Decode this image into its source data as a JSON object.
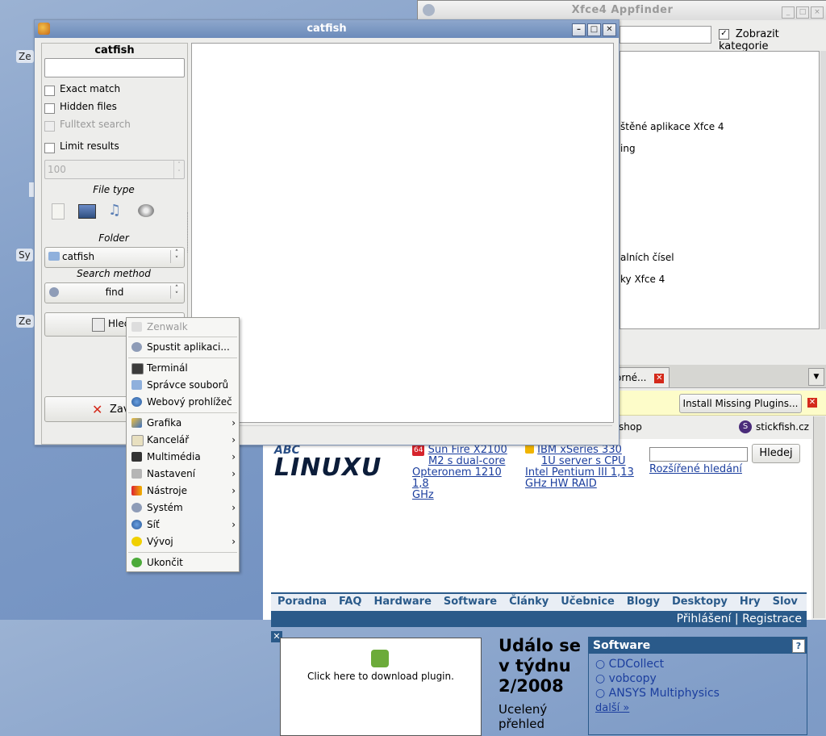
{
  "desktop": {
    "stubs": [
      "Ze",
      "Sy",
      "Ze"
    ]
  },
  "appfinder": {
    "title": "Xfce4 Appfinder",
    "show_categories_label": "Zobrazit kategorie",
    "list_fragments": [
      "štěné aplikace Xfce 4",
      "ing",
      "alních čísel",
      "ky Xfce 4"
    ]
  },
  "browser": {
    "tab_label": "orné...",
    "plugin_button": "Install Missing Plugins...",
    "bookmark_fragment": "shop",
    "bookmark_site": "stickfish.cz",
    "ad1": {
      "badge": "64",
      "line1": "Sun Fire X2100",
      "line2": "M2 s dual-core",
      "line3": "Opteronem 1210 1,8",
      "line4": "GHz"
    },
    "ad2": {
      "line1": "IBM xSeries 330",
      "line2": "1U server s CPU",
      "line3": "Intel Pentium III 1,13",
      "line4": "GHz HW RAID"
    },
    "search_button": "Hledej",
    "advanced_search": "Rozšířené hledání",
    "logo": "ABC LINUXU",
    "nav": [
      "Poradna",
      "FAQ",
      "Hardware",
      "Software",
      "Články",
      "Učebnice",
      "Blogy",
      "Desktopy",
      "Hry",
      "Slov"
    ],
    "login": "Přihlášení",
    "register": "Registrace",
    "plugin_text": "Click here to download plugin.",
    "headline": [
      "Událo se",
      "v týdnu",
      "2/2008"
    ],
    "teaser": [
      "Ucelený",
      "přehled"
    ],
    "software_box": {
      "title": "Software",
      "items": [
        "CDCollect",
        "vobcopy",
        "ANSYS Multiphysics"
      ],
      "more": "další »"
    }
  },
  "catfish": {
    "title": "catfish",
    "panel_title": "catfish",
    "search_value": "",
    "options": {
      "exact": "Exact match",
      "hidden": "Hidden files",
      "fulltext": "Fulltext search",
      "limit": "Limit results"
    },
    "limit_value": "100",
    "file_type_label": "File type",
    "folder_label": "Folder",
    "folder_value": "catfish",
    "method_label": "Search method",
    "method_value": "find",
    "search_button": "Hledat",
    "search_button_visible": "Hled",
    "close_button_visible": "Zav"
  },
  "menu": {
    "header": "Zenwalk",
    "items": [
      {
        "label": "Spustit aplikaci...",
        "submenu": false
      },
      {
        "label": "Terminál",
        "submenu": false
      },
      {
        "label": "Správce souborů",
        "submenu": false
      },
      {
        "label": "Webový prohlížeč",
        "submenu": false
      },
      {
        "label": "Grafika",
        "submenu": true
      },
      {
        "label": "Kancelář",
        "submenu": true
      },
      {
        "label": "Multimédia",
        "submenu": true
      },
      {
        "label": "Nastavení",
        "submenu": true
      },
      {
        "label": "Nástroje",
        "submenu": true
      },
      {
        "label": "Systém",
        "submenu": true
      },
      {
        "label": "Síť",
        "submenu": true
      },
      {
        "label": "Vývoj",
        "submenu": true
      },
      {
        "label": "Ukončit",
        "submenu": false
      }
    ]
  }
}
